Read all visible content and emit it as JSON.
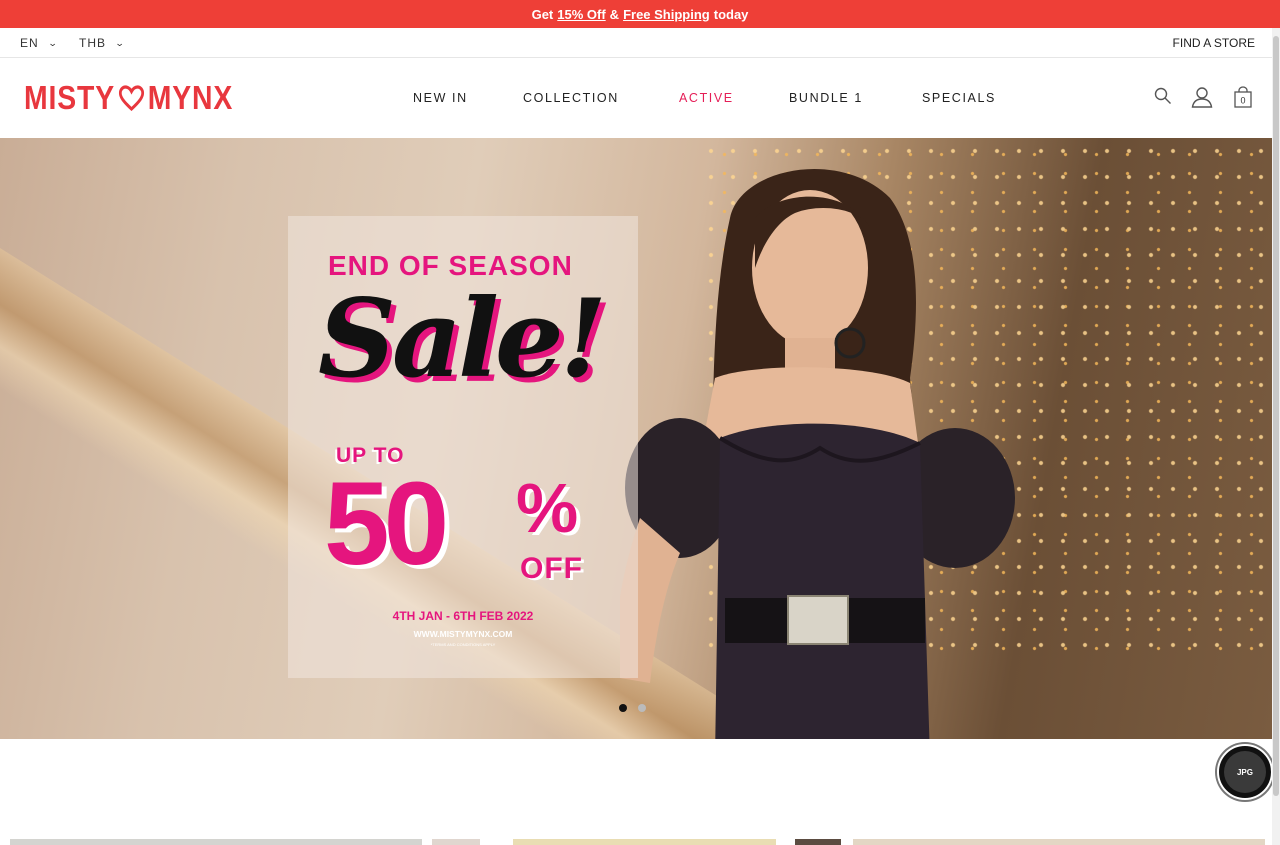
{
  "promo_bar": {
    "prefix": "Get",
    "discount_link": "15% Off",
    "amp": "&",
    "shipping_link": "Free Shipping",
    "suffix": "today"
  },
  "utility": {
    "language": "EN",
    "currency": "THB",
    "find_store": "FIND A STORE"
  },
  "header": {
    "logo_left": "MISTY",
    "logo_right": "MYNX",
    "cart_count": "0"
  },
  "nav": [
    "NEW IN",
    "COLLECTION",
    "ACTIVE",
    "BUNDLE 1",
    "SPECIALS"
  ],
  "nav_active_index": 2,
  "hero": {
    "headline": "END OF SEASON",
    "sale": "Sale!",
    "up_to": "UP TO",
    "percent_number": "50",
    "percent_sign": "%",
    "off": "OFF",
    "dates": "4TH JAN - 6TH FEB 2022",
    "url": "WWW.MISTYMYNX.COM",
    "terms": "*TERMS AND CONDITIONS APPLY"
  },
  "carousel": {
    "slides": 2,
    "active": 0
  },
  "chat_widget": {
    "label": "JPG"
  },
  "colors": {
    "brand_red": "#ee3f37",
    "active_nav": "#e51e57",
    "sale_pink": "#e5157e"
  }
}
